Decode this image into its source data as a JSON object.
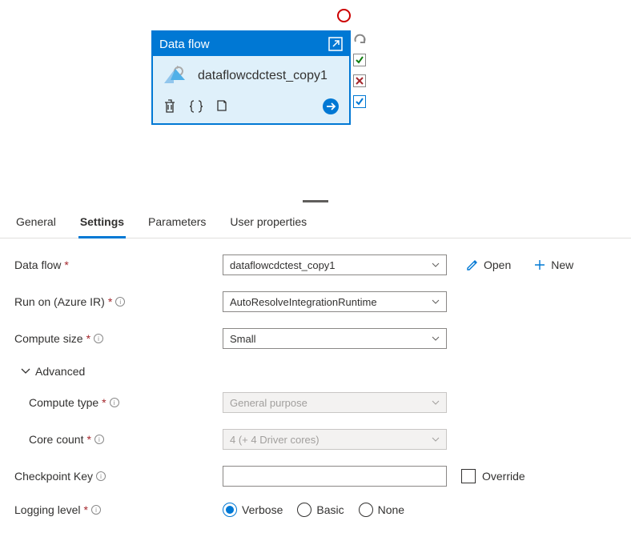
{
  "card": {
    "title": "Data flow",
    "name": "dataflowcdctest_copy1"
  },
  "tabs": {
    "general": "General",
    "settings": "Settings",
    "parameters": "Parameters",
    "userProperties": "User properties"
  },
  "form": {
    "dataflow": {
      "label": "Data flow",
      "value": "dataflowcdctest_copy1",
      "open": "Open",
      "new": "New"
    },
    "runOn": {
      "label": "Run on (Azure IR)",
      "value": "AutoResolveIntegrationRuntime"
    },
    "computeSize": {
      "label": "Compute size",
      "value": "Small"
    },
    "advanced": "Advanced",
    "computeType": {
      "label": "Compute type",
      "value": "General purpose"
    },
    "coreCount": {
      "label": "Core count",
      "value": "4 (+ 4 Driver cores)"
    },
    "checkpointKey": {
      "label": "Checkpoint Key",
      "value": "",
      "override": "Override"
    },
    "loggingLevel": {
      "label": "Logging level",
      "verbose": "Verbose",
      "basic": "Basic",
      "none": "None"
    }
  }
}
